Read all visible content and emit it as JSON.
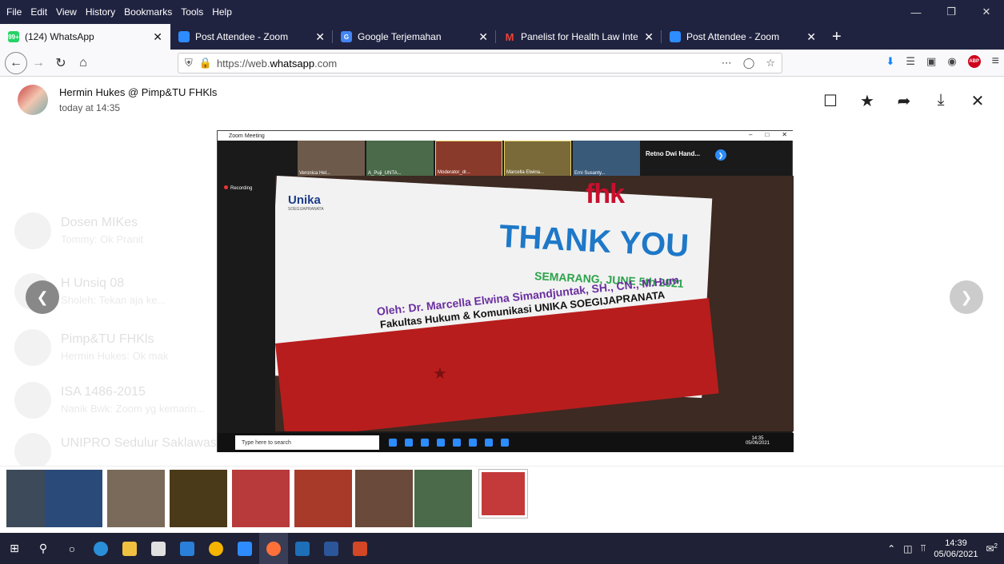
{
  "menubar": {
    "items": [
      "File",
      "Edit",
      "View",
      "History",
      "Bookmarks",
      "Tools",
      "Help"
    ]
  },
  "tabs": [
    {
      "title": "(124) WhatsApp",
      "active": true,
      "favicon": "whatsapp-icon",
      "color": "#25d366"
    },
    {
      "title": "Post Attendee - Zoom",
      "active": false,
      "favicon": "zoom-icon",
      "color": "#2d8cff"
    },
    {
      "title": "Google Terjemahan",
      "active": false,
      "favicon": "google-translate-icon",
      "color": "#4285f4"
    },
    {
      "title": "Panelist for Health Law Internat",
      "active": false,
      "favicon": "gmail-icon",
      "color": "#ea4335"
    },
    {
      "title": "Post Attendee - Zoom",
      "active": false,
      "favicon": "zoom-icon",
      "color": "#2d8cff"
    }
  ],
  "url": {
    "prefix": "https://web.",
    "host": "whatsapp",
    "suffix": ".com"
  },
  "viewer": {
    "sender": "Hermin Hukes @ Pimp&TU FHKls",
    "time": "today at 14:35"
  },
  "zoom": {
    "title": "Zoom Meeting",
    "participants": [
      "Veronica Hel...",
      "A_Puji_UNTA...",
      "Moderator_dr...",
      "Marcella Elwina...",
      "Erni Susanty..."
    ],
    "spotlight": "Retno Dwi Hand...",
    "recording": "Recording",
    "taskbar_search": "Type here to search",
    "taskbar_time": "14:35",
    "taskbar_date": "05/06/2021"
  },
  "slide": {
    "unika": "Unika",
    "unika_sub": "SOEGIJAPRANATA",
    "fhk": "fhk",
    "thankyou": "THANK YOU",
    "place_date": "SEMARANG, JUNE 5th 2021",
    "oleh": "Oleh: Dr. Marcella Elwina Simandjuntak, SH., CN., M.Hum",
    "faculty": "Fakultas Hukum & Komunikasi UNIKA SOEGIJAPRANATA"
  },
  "chatlist": [
    {
      "name": "Dosen MIKes",
      "preview": "Tommy: Ok Pranit"
    },
    {
      "name": "H Unsiq 08",
      "preview": "Sholeh: Tekan aja ke..."
    },
    {
      "name": "Pimp&TU FHKls",
      "preview": "Hermin Hukes: Ok mak"
    },
    {
      "name": "ISA 1486-2015",
      "preview": "Nanik Bwk: Zoom yg kemarin..."
    },
    {
      "name": "UNIPRO Sedulur Saklawase",
      "preview": ""
    }
  ],
  "taskbar": {
    "time": "14:39",
    "date": "05/06/2021",
    "notifications": "2"
  }
}
